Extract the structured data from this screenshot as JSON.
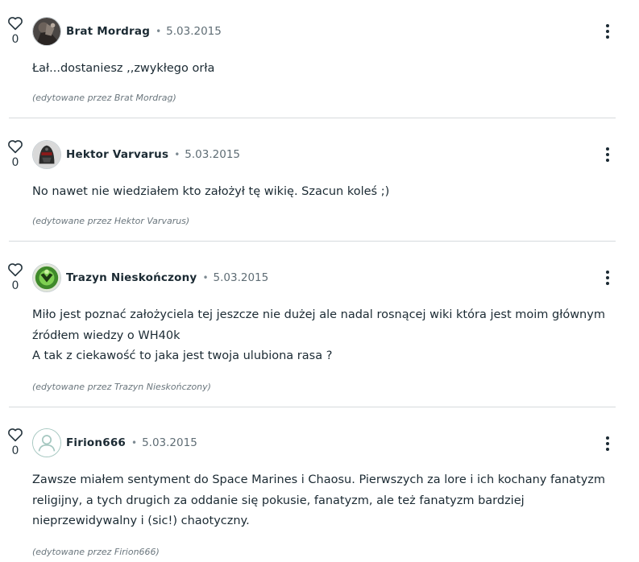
{
  "comments": [
    {
      "likes": "0",
      "author": "Brat Mordrag",
      "date": "5.03.2015",
      "lines": [
        "Łał...dostaniesz ,,zwykłego orła"
      ],
      "edited": "(edytowane przez Brat Mordrag)",
      "avatar_icon": "dark-warrior-avatar"
    },
    {
      "likes": "0",
      "author": "Hektor Varvarus",
      "date": "5.03.2015",
      "lines": [
        "No nawet nie wiedziałem kto założył tę wikię. Szacun koleś ;)"
      ],
      "edited": "(edytowane przez Hektor Varvarus)",
      "avatar_icon": "helmet-avatar"
    },
    {
      "likes": "0",
      "author": "Trazyn Nieskończony",
      "date": "5.03.2015",
      "lines": [
        "Miło jest poznać założyciela tej jeszcze nie dużej ale nadal rosnącej wiki która jest moim głównym",
        "źródłem wiedzy o WH40k",
        "A tak z ciekawość to jaka jest twoja ulubiona rasa ?"
      ],
      "edited": "(edytowane przez Trazyn Nieskończony)",
      "avatar_icon": "green-necron-avatar"
    },
    {
      "likes": "0",
      "author": "Firion666",
      "date": "5.03.2015",
      "lines": [
        "Zawsze miałem sentyment do Space Marines i Chaosu. Pierwszych za lore i ich kochany fanatyzm",
        "religijny, a tych drugich za oddanie się pokusie, fanatyzm, ale też fanatyzm bardziej",
        "nieprzewidywalny i (sic!) chaotyczny."
      ],
      "edited": "(edytowane przez Firion666)",
      "avatar_icon": "default-user-avatar"
    }
  ],
  "colors": {
    "text": "#1b2a33",
    "muted": "#6a767d",
    "divider": "#d6dadd",
    "avatar_default": "#a5c7c0"
  }
}
